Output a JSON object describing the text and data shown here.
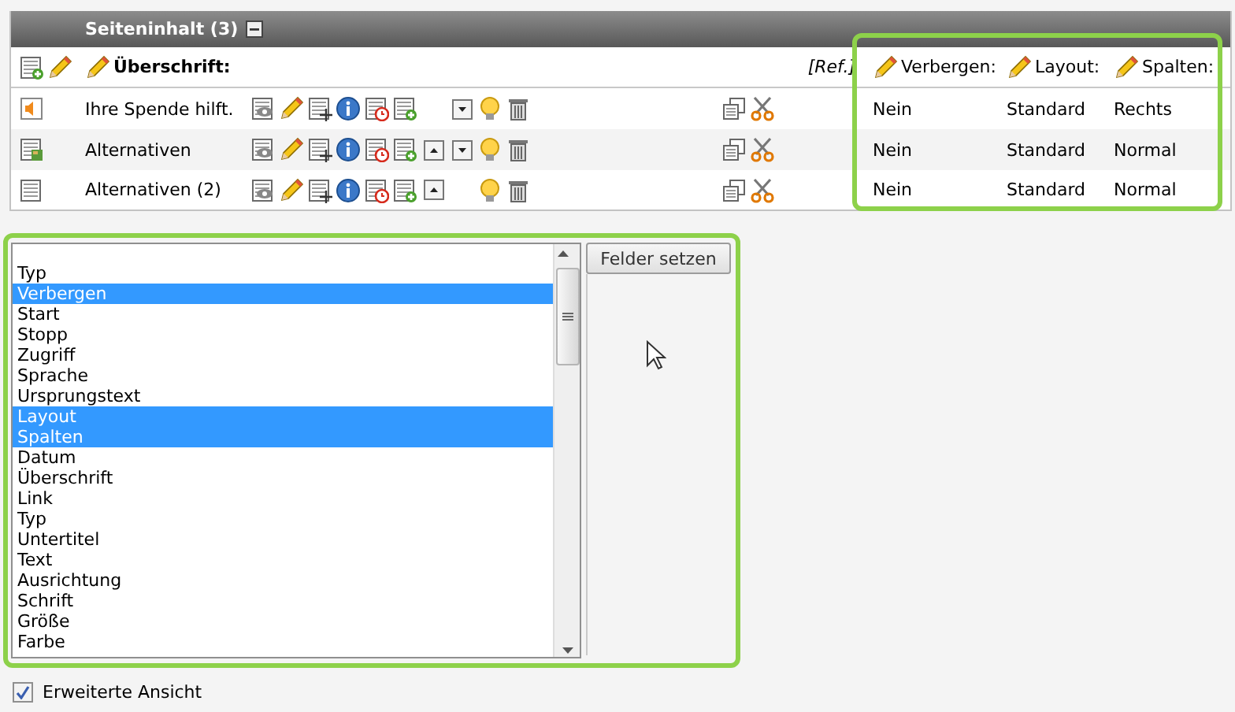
{
  "panel": {
    "title": "Seiteninhalt (3)"
  },
  "columns": {
    "title": "Überschrift:",
    "ref": "[Ref.]",
    "fields": [
      "Verbergen:",
      "Layout:",
      "Spalten:"
    ]
  },
  "rows": [
    {
      "kind": "audio",
      "title": "Ihre Spende hilft.",
      "move_up": false,
      "move_down": true,
      "values": [
        "Nein",
        "Standard",
        "Rechts"
      ]
    },
    {
      "kind": "image",
      "title": "Alternativen",
      "move_up": true,
      "move_down": true,
      "values": [
        "Nein",
        "Standard",
        "Normal"
      ]
    },
    {
      "kind": "table",
      "title": "Alternativen (2)",
      "move_up": true,
      "move_down": false,
      "values": [
        "Nein",
        "Standard",
        "Normal"
      ]
    }
  ],
  "field_list": {
    "items": [
      {
        "label": "Typ",
        "selected": false
      },
      {
        "label": "Verbergen",
        "selected": true
      },
      {
        "label": "Start",
        "selected": false
      },
      {
        "label": "Stopp",
        "selected": false
      },
      {
        "label": "Zugriff",
        "selected": false
      },
      {
        "label": "Sprache",
        "selected": false
      },
      {
        "label": "Ursprungstext",
        "selected": false
      },
      {
        "label": "Layout",
        "selected": true
      },
      {
        "label": "Spalten",
        "selected": true
      },
      {
        "label": "Datum",
        "selected": false
      },
      {
        "label": "Überschrift",
        "selected": false
      },
      {
        "label": "Link",
        "selected": false
      },
      {
        "label": "Typ",
        "selected": false
      },
      {
        "label": "Untertitel",
        "selected": false
      },
      {
        "label": "Text",
        "selected": false
      },
      {
        "label": "Ausrichtung",
        "selected": false
      },
      {
        "label": "Schrift",
        "selected": false
      },
      {
        "label": "Größe",
        "selected": false
      },
      {
        "label": "Farbe",
        "selected": false
      }
    ]
  },
  "apply_button": "Felder setzen",
  "extended_view": {
    "label": "Erweiterte Ansicht",
    "checked": true
  }
}
